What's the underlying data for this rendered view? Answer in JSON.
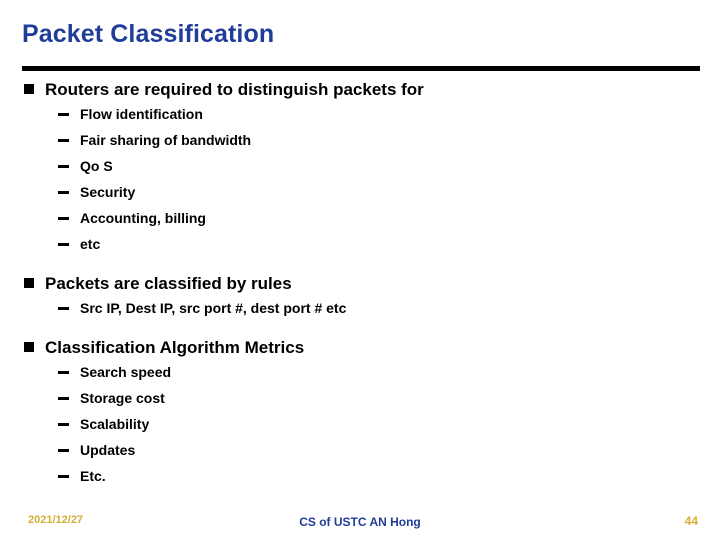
{
  "slide": {
    "title": "Packet Classification",
    "title_color": "#1f3d99",
    "background_color": "#ffffff",
    "rule_color": "#000000"
  },
  "content": {
    "groups": [
      {
        "bullet": "Routers are required to distinguish packets for",
        "sub_bullets": [
          "Flow identification",
          "Fair sharing of bandwidth",
          "Qo S",
          "Security",
          "Accounting, billing",
          "etc"
        ]
      },
      {
        "bullet": "Packets are classified by rules",
        "sub_bullets": [
          "Src IP, Dest IP, src port #, dest port # etc"
        ]
      },
      {
        "bullet": "Classification Algorithm Metrics",
        "sub_bullets": [
          "Search speed",
          "Storage cost",
          "Scalability",
          "Updates",
          "Etc."
        ]
      }
    ]
  },
  "footer": {
    "date": "2021/12/27",
    "center": "CS of USTC AN Hong",
    "page_number": "44",
    "date_color": "#d4af37",
    "center_color": "#1f3d99",
    "page_number_color": "#d4af37"
  },
  "icons": {
    "level1_marker": "filled-square-bullet-icon",
    "level2_marker": "dash-bullet-icon"
  }
}
